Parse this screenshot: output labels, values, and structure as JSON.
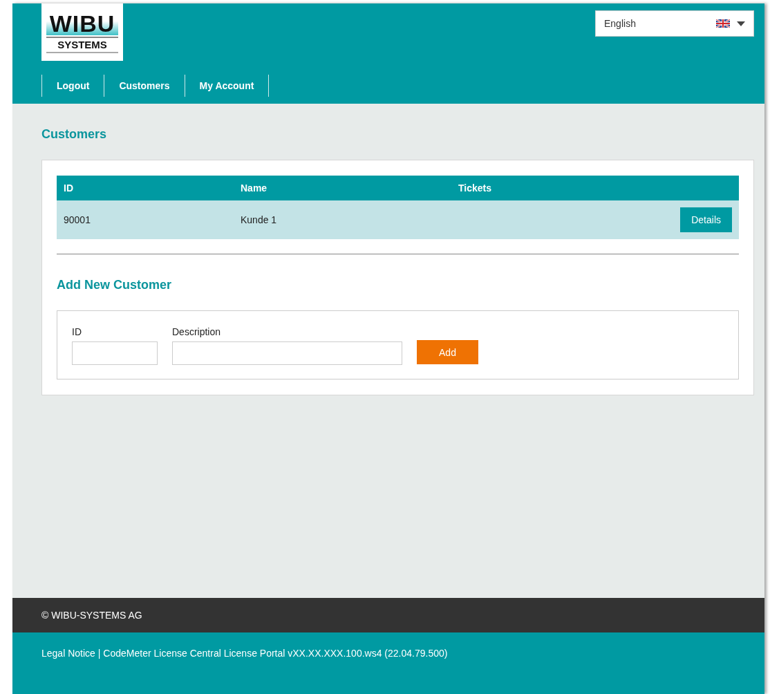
{
  "logo": {
    "wordmark": "WIBU",
    "subtitle": "SYSTEMS"
  },
  "language": {
    "value": "English"
  },
  "nav": [
    {
      "label": "Logout"
    },
    {
      "label": "Customers"
    },
    {
      "label": "My Account"
    }
  ],
  "page_title": "Customers",
  "table": {
    "columns": [
      "ID",
      "Name",
      "Tickets"
    ],
    "rows": [
      {
        "cells": [
          "90001",
          "Kunde 1",
          ""
        ],
        "action": "Details"
      }
    ]
  },
  "add_form": {
    "title": "Add New Customer",
    "fields": [
      {
        "label": "ID",
        "kind": "short"
      },
      {
        "label": "Description",
        "kind": "wide"
      }
    ],
    "button": "Add"
  },
  "footer": {
    "copyright": "© WIBU-SYSTEMS AG",
    "legal_link": "Legal Notice",
    "version": "| CodeMeter License Central License Portal vXX.XX.XXX.100.ws4 (22.04.79.500)"
  }
}
